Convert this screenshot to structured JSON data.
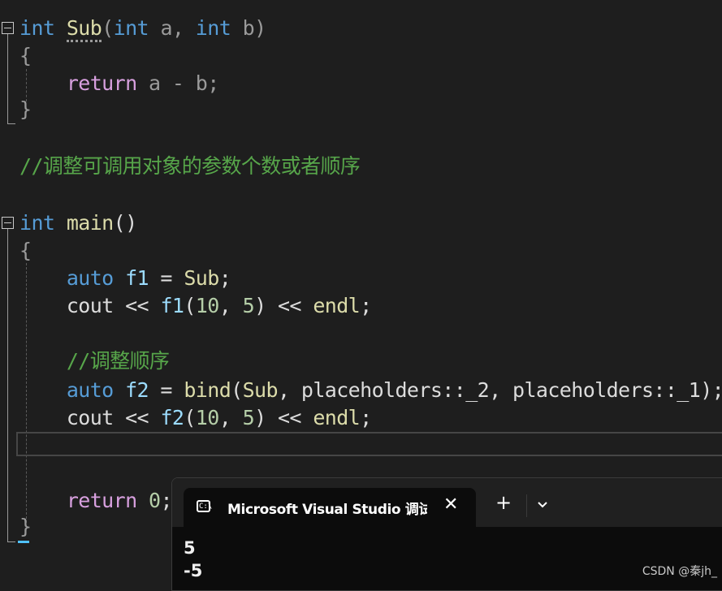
{
  "code": {
    "sub_sig": {
      "kw1": "int",
      "name": "Sub",
      "p1": "(",
      "kw2": "int",
      "a": "a",
      "comma": ",",
      "kw3": "int",
      "b": "b",
      "p2": ")"
    },
    "brace_open": "{",
    "brace_close": "}",
    "ret1": {
      "kw": "return",
      "a": "a",
      "op": "-",
      "b": "b",
      "semi": ";"
    },
    "comment1": "//调整可调用对象的参数个数或者顺序",
    "main_sig": {
      "kw": "int",
      "name": "main",
      "parens": "()"
    },
    "l_auto1": {
      "kw": "auto",
      "var": "f1",
      "rest": " = ",
      "fn": "Sub",
      "semi": ";"
    },
    "l_cout1": {
      "cout": "cout",
      "op": " << ",
      "var": "f1",
      "open": "(",
      "n1": "10",
      "comma": ", ",
      "n2": "5",
      "close": ")",
      "op2": " << ",
      "endl": "endl",
      "semi": ";"
    },
    "comment2": "//调整顺序",
    "l_auto2": {
      "kw": "auto",
      "var": "f2",
      "eq": " = ",
      "fn": "bind",
      "open": "(",
      "sub": "Sub",
      "args": ", placeholders::_2, placeholders::_1",
      "close": ")",
      "semi": ";"
    },
    "l_cout2": {
      "cout": "cout",
      "op": " << ",
      "var": "f2",
      "open": "(",
      "n1": "10",
      "comma": ", ",
      "n2": "5",
      "close": ")",
      "op2": " << ",
      "endl": "endl",
      "semi": ";"
    },
    "ret2": {
      "kw": "return",
      "num": "0",
      "semi": ";"
    }
  },
  "terminal": {
    "icon_text": "C:\\",
    "tab_title": "Microsoft Visual Studio 调试控制台",
    "close_glyph": "✕",
    "new_tab_glyph": "+",
    "output": [
      "5",
      "-5"
    ]
  },
  "watermark": "CSDN @秦jh_"
}
